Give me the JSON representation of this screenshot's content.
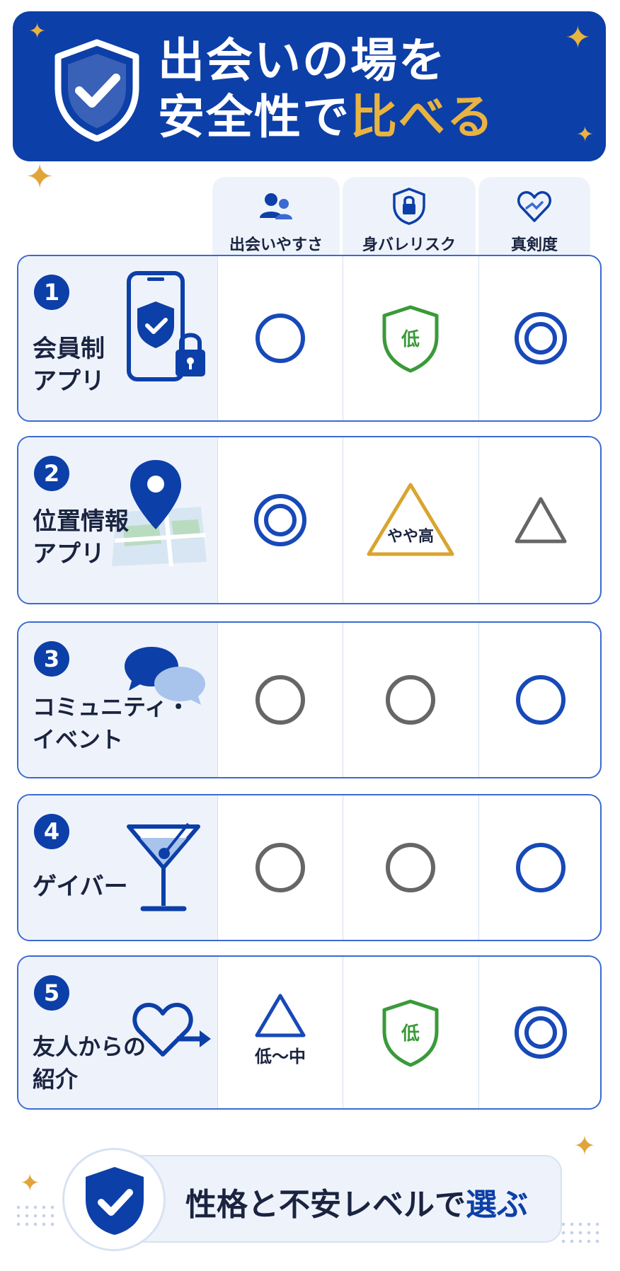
{
  "header": {
    "title_line1": "出会いの場を",
    "title_line2_prefix": "安全性で",
    "title_line2_accent": "比べる",
    "icon": "shield-check-icon"
  },
  "columns": [
    {
      "label": "出会いやすさ",
      "icon": "people-icon"
    },
    {
      "label": "身バレリスク",
      "icon": "lock-shield-icon"
    },
    {
      "label": "真剣度",
      "icon": "heart-hands-icon"
    }
  ],
  "rows": [
    {
      "number": "1",
      "name": "会員制\nアプリ",
      "icon": "phone-shield-lock-icon",
      "ratings": [
        {
          "mark": "circle",
          "color": "#1749b8"
        },
        {
          "mark": "shield",
          "label": "低",
          "color": "#3a9a3a"
        },
        {
          "mark": "double-circle",
          "color": "#1749b8"
        }
      ]
    },
    {
      "number": "2",
      "name": "位置情報\nアプリ",
      "icon": "map-pin-icon",
      "ratings": [
        {
          "mark": "double-circle",
          "color": "#1749b8"
        },
        {
          "mark": "triangle-label",
          "label": "やや高",
          "color": "#d9a52f"
        },
        {
          "mark": "triangle",
          "color": "#666666"
        }
      ]
    },
    {
      "number": "3",
      "name": "コミュニティ・\nイベント",
      "icon": "chat-bubbles-icon",
      "ratings": [
        {
          "mark": "circle",
          "color": "#666666"
        },
        {
          "mark": "circle",
          "color": "#666666"
        },
        {
          "mark": "circle",
          "color": "#1749b8"
        }
      ]
    },
    {
      "number": "4",
      "name": "ゲイバー",
      "icon": "cocktail-glass-icon",
      "ratings": [
        {
          "mark": "circle",
          "color": "#666666"
        },
        {
          "mark": "circle",
          "color": "#666666"
        },
        {
          "mark": "circle",
          "color": "#1749b8"
        }
      ]
    },
    {
      "number": "5",
      "name": "友人からの\n紹介",
      "icon": "heart-arrow-icon",
      "ratings": [
        {
          "mark": "triangle",
          "label": "低〜中",
          "color": "#1749b8"
        },
        {
          "mark": "shield",
          "label": "低",
          "color": "#3a9a3a"
        },
        {
          "mark": "double-circle",
          "color": "#1749b8"
        }
      ]
    }
  ],
  "footer": {
    "text_prefix": "性格と不安レベルで",
    "text_accent": "選ぶ",
    "icon": "shield-check-icon"
  },
  "colors": {
    "primary": "#0d3fa8",
    "accent_gold": "#e8b341",
    "panel": "#eef3fb",
    "low_green": "#3a9a3a"
  }
}
